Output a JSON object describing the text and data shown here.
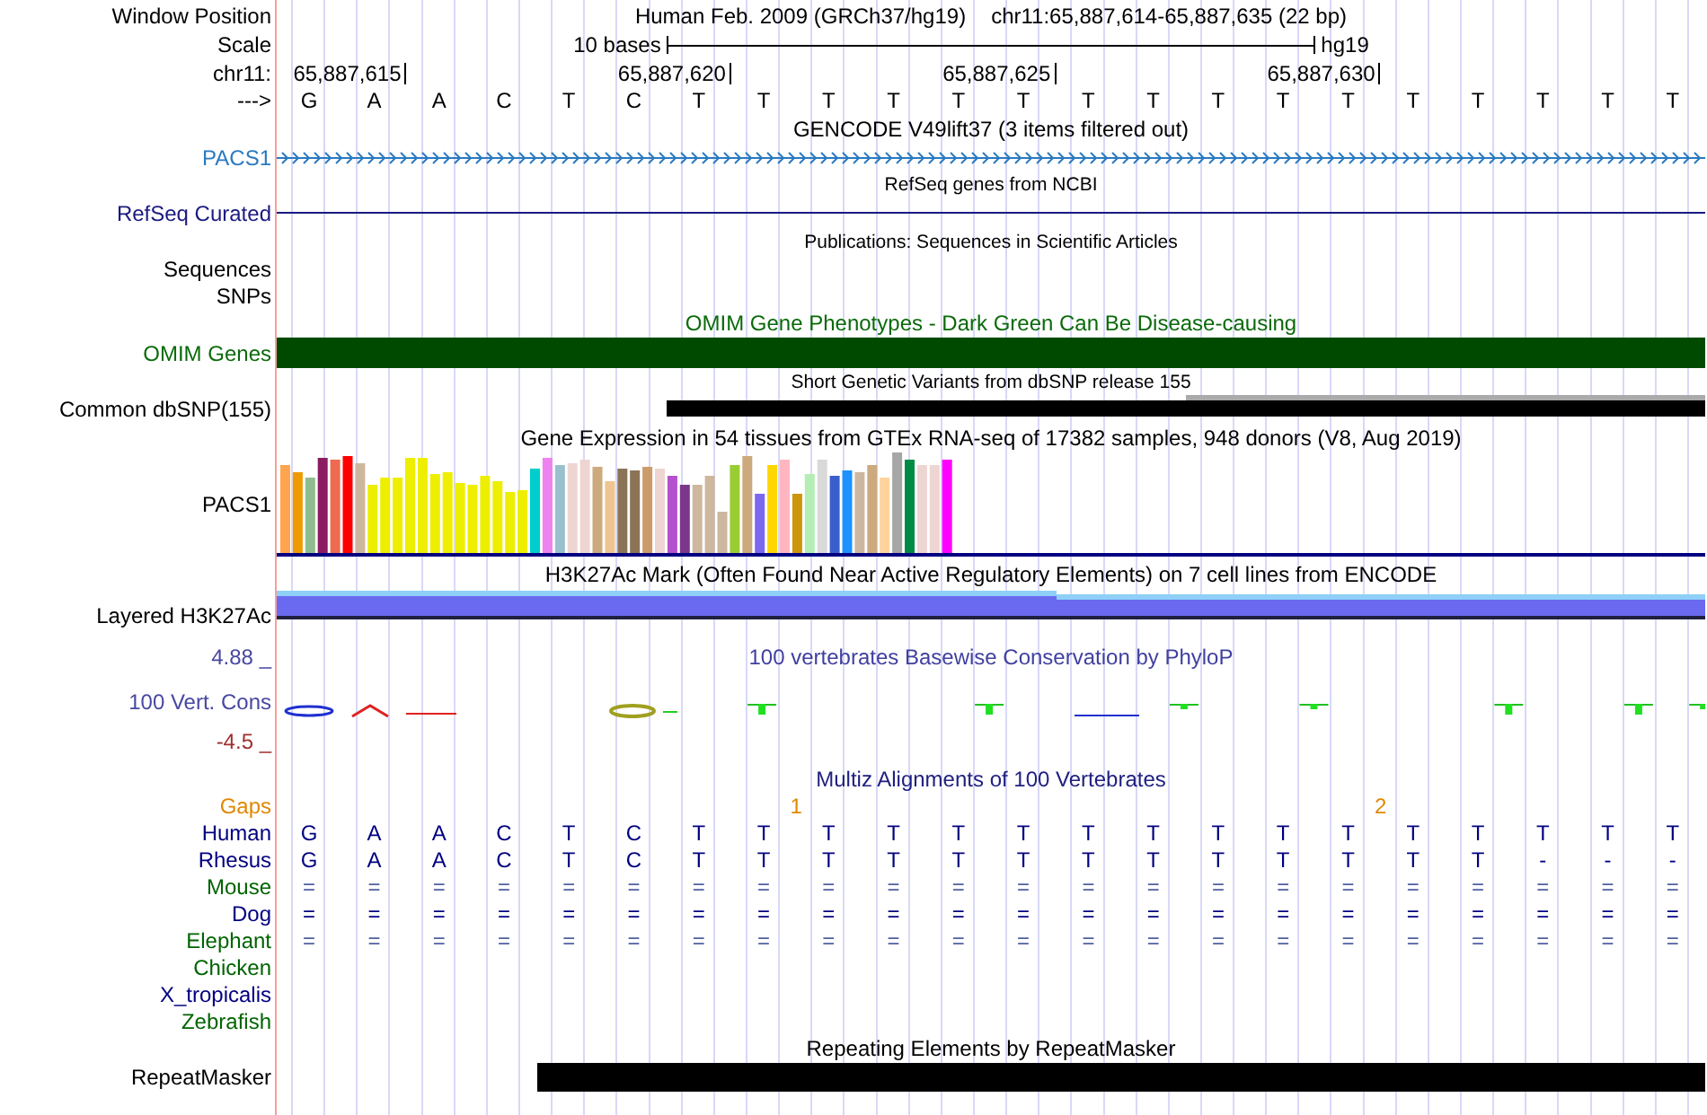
{
  "header": {
    "position_label": "Window Position",
    "assembly": "Human Feb. 2009 (GRCh37/hg19)",
    "range": "chr11:65,887,614-65,887,635 (22 bp)",
    "scale_label": "Scale",
    "scale_text": "10 bases",
    "scale_assembly": "hg19",
    "chrom_label": "chr11:",
    "positions": [
      "65,887,615",
      "65,887,620",
      "65,887,625",
      "65,887,630"
    ],
    "strand_label": "--->",
    "bases": [
      "G",
      "A",
      "A",
      "C",
      "T",
      "C",
      "T",
      "T",
      "T",
      "T",
      "T",
      "T",
      "T",
      "T",
      "T",
      "T",
      "T",
      "T",
      "T",
      "T",
      "T",
      "T"
    ]
  },
  "tracks": [
    {
      "kind": "gene",
      "title": "GENCODE V49lift37 (3 items filtered out)",
      "label": "PACS1"
    },
    {
      "kind": "refseq",
      "title": "RefSeq genes from NCBI",
      "label": "RefSeq Curated"
    },
    {
      "kind": "publications",
      "title": "Publications: Sequences in Scientific Articles",
      "labels": [
        "Sequences",
        "SNPs"
      ]
    },
    {
      "kind": "omim",
      "title": "OMIM Gene Phenotypes - Dark Green Can Be Disease-causing",
      "label": "OMIM Genes"
    },
    {
      "kind": "snp",
      "title": "Short Genetic Variants from dbSNP release 155",
      "label": "Common dbSNP(155)"
    },
    {
      "kind": "expression",
      "title": "Gene Expression in 54 tissues from GTEx RNA-seq of 17382 samples, 948 donors (V8, Aug 2019)",
      "label": "PACS1"
    },
    {
      "kind": "layered",
      "title": "H3K27Ac Mark (Often Found Near Active Regulatory Elements) on 7 cell lines from ENCODE",
      "label": "Layered H3K27Ac"
    },
    {
      "kind": "conservation",
      "title": "100 vertebrates Basewise Conservation by PhyloP",
      "label": "100 Vert. Cons",
      "max": "4.88 _",
      "min": "-4.5 _"
    },
    {
      "kind": "multiz",
      "title": "Multiz Alignments of 100 Vertebrates",
      "gaps_label": "Gaps",
      "gaps": [
        "1",
        "2"
      ],
      "species": [
        {
          "name": "Human",
          "color": "#000080",
          "bases": [
            "G",
            "A",
            "A",
            "C",
            "T",
            "C",
            "T",
            "T",
            "T",
            "T",
            "T",
            "T",
            "T",
            "T",
            "T",
            "T",
            "T",
            "T",
            "T",
            "T",
            "T",
            "T"
          ]
        },
        {
          "name": "Rhesus",
          "color": "#000080",
          "bases": [
            "G",
            "A",
            "A",
            "C",
            "T",
            "C",
            "T",
            "T",
            "T",
            "T",
            "T",
            "T",
            "T",
            "T",
            "T",
            "T",
            "T",
            "T",
            "T",
            "-",
            "-",
            "-"
          ]
        },
        {
          "name": "Mouse",
          "color": "#006400",
          "bases": [
            "=",
            "=",
            "=",
            "=",
            "=",
            "=",
            "=",
            "=",
            "=",
            "=",
            "=",
            "=",
            "=",
            "=",
            "=",
            "=",
            "=",
            "=",
            "=",
            "=",
            "=",
            "="
          ]
        },
        {
          "name": "Dog",
          "color": "#000080",
          "bases": [
            "=",
            "=",
            "=",
            "=",
            "=",
            "=",
            "=",
            "=",
            "=",
            "=",
            "=",
            "=",
            "=",
            "=",
            "=",
            "=",
            "=",
            "=",
            "=",
            "=",
            "=",
            "="
          ]
        },
        {
          "name": "Elephant",
          "color": "#006400",
          "bases": [
            "=",
            "=",
            "=",
            "=",
            "=",
            "=",
            "=",
            "=",
            "=",
            "=",
            "=",
            "=",
            "=",
            "=",
            "=",
            "=",
            "=",
            "=",
            "=",
            "=",
            "=",
            "="
          ]
        },
        {
          "name": "Chicken",
          "color": "#006400"
        },
        {
          "name": "X_tropicalis",
          "color": "#000080"
        },
        {
          "name": "Zebrafish",
          "color": "#006400"
        }
      ]
    },
    {
      "kind": "repeat",
      "title": "Repeating Elements by RepeatMasker",
      "label": "RepeatMasker"
    }
  ]
}
